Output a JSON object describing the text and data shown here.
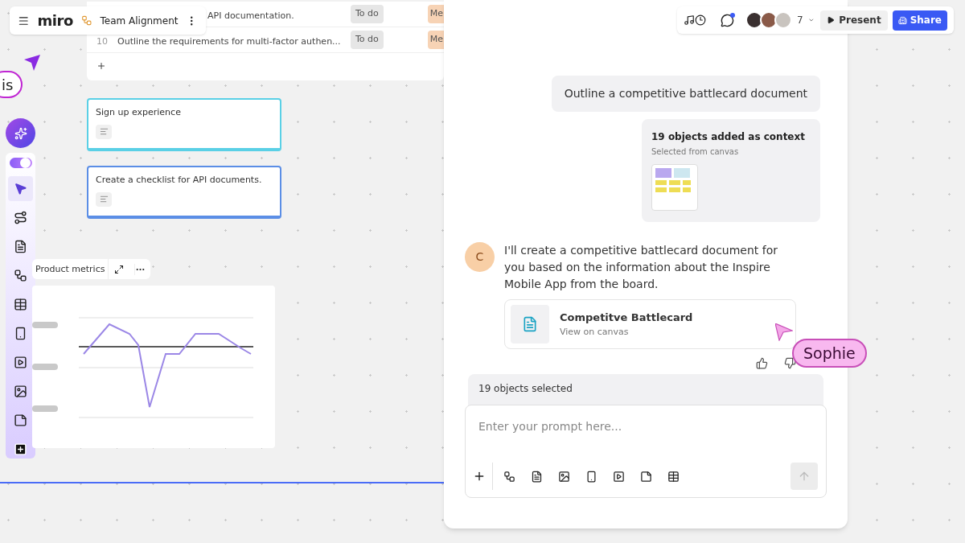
{
  "header": {
    "logo": "miro",
    "board_name": "Team Alignment"
  },
  "table": {
    "rows": [
      {
        "number": "",
        "text": "API documentation.",
        "status": "To do",
        "priority": "Me"
      },
      {
        "number": "10",
        "text": "Outline the requirements for multi-factor authen...",
        "status": "To do",
        "priority": "Me"
      }
    ]
  },
  "cursor_label": "is",
  "toolbar": {
    "ai_mode_on": true,
    "items": [
      {
        "kind": "select",
        "selected": true
      },
      {
        "kind": "connector",
        "selected": false
      },
      {
        "kind": "document",
        "selected": false
      },
      {
        "kind": "shapes",
        "selected": false
      },
      {
        "kind": "table",
        "selected": false
      },
      {
        "kind": "phone",
        "selected": false
      },
      {
        "kind": "video",
        "selected": false
      },
      {
        "kind": "image",
        "selected": false
      },
      {
        "kind": "sticky",
        "selected": false
      },
      {
        "kind": "more",
        "selected": false
      }
    ]
  },
  "cards": [
    {
      "text": "Sign up experience",
      "color": "#5ad0e6"
    },
    {
      "text": "Create a checklist for API documents.",
      "color": "#5b8ee6"
    }
  ],
  "chart_widget": {
    "title": "Product metrics"
  },
  "topbar": {
    "collaborator_count": "7",
    "present": "Present",
    "share": "Share"
  },
  "chat": {
    "user_message": "Outline a competitive battlecard document",
    "context": {
      "title": "19 objects added as context",
      "subtitle": "Selected from canvas"
    },
    "assistant": {
      "avatar": "C",
      "message": "I'll create a competitive battlecard document for you based on the information about the Inspire Mobile App from the board.",
      "doc_title": "Competitve Battlecard",
      "doc_subtitle": "View on canvas"
    },
    "cursor_name": "Sophie",
    "selection": "19 objects selected",
    "prompt": {
      "placeholder": "Enter your prompt here..."
    },
    "prompt_tools": [
      {
        "kind": "shapes"
      },
      {
        "kind": "document"
      },
      {
        "kind": "image"
      },
      {
        "kind": "phone"
      },
      {
        "kind": "video"
      },
      {
        "kind": "sticky"
      },
      {
        "kind": "table"
      }
    ]
  }
}
